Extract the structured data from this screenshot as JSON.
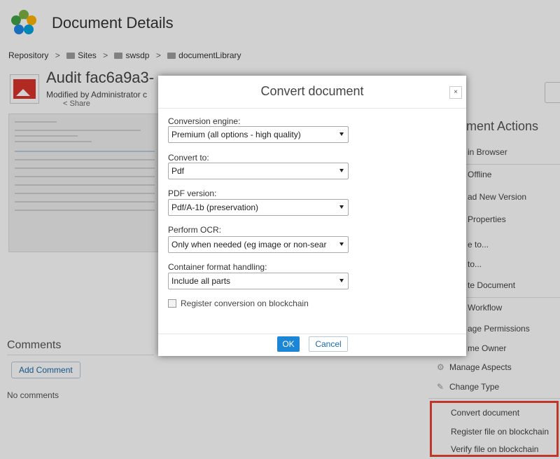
{
  "header": {
    "title": "Document Details"
  },
  "breadcrumb": {
    "items": [
      "Repository",
      "Sites",
      "swsdp",
      "documentLibrary"
    ]
  },
  "document": {
    "title": "Audit fac6a9a3-",
    "modified": "Modified by Administrator c",
    "share": "Share"
  },
  "dialog": {
    "title": "Convert document",
    "close": "×",
    "engine_label": "Conversion engine:",
    "engine_value": "Premium (all options - high quality)",
    "convert_to_label": "Convert to:",
    "convert_to_value": "Pdf",
    "pdf_version_label": "PDF version:",
    "pdf_version_value": "Pdf/A-1b (preservation)",
    "ocr_label": "Perform OCR:",
    "ocr_value": "Only when needed (eg image or non-sear",
    "container_label": "Container format handling:",
    "container_value": "Include all parts",
    "register_label": "Register conversion on blockchain",
    "ok": "OK",
    "cancel": "Cancel"
  },
  "actions": {
    "title": "ment Actions",
    "items": [
      "in Browser",
      "Offline",
      "ad New Version",
      "Properties",
      "e to...",
      "to...",
      "te Document",
      "Workflow",
      "age Permissions",
      "me Owner",
      "Manage Aspects",
      "Change Type",
      "Convert document",
      "Register file on blockchain",
      "Verify file on blockchain"
    ]
  },
  "comments": {
    "title": "Comments",
    "add": "Add Comment",
    "empty": "No comments"
  },
  "colors": {
    "accent": "#1b86d6",
    "highlight": "#ea4335",
    "doc_icon": "#d9322a"
  }
}
